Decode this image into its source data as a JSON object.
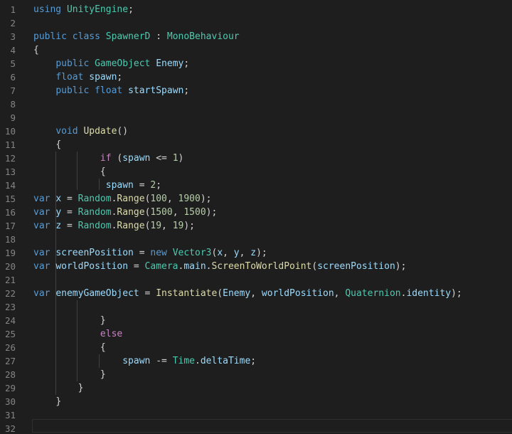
{
  "editor": {
    "language": "csharp",
    "theme_colors": {
      "background": "#1e1e1e",
      "keyword": "#569cd6",
      "control": "#c586c0",
      "type": "#4ec9b0",
      "function": "#dcdcaa",
      "variable": "#9cdcfe",
      "number": "#b5cea8",
      "line_number": "#858585"
    },
    "lines": [
      {
        "n": "1",
        "tokens": [
          {
            "t": "using",
            "c": "kw"
          },
          {
            "t": " "
          },
          {
            "t": "UnityEngine",
            "c": "type"
          },
          {
            "t": ";"
          }
        ]
      },
      {
        "n": "2",
        "tokens": []
      },
      {
        "n": "3",
        "tokens": [
          {
            "t": "public",
            "c": "kw"
          },
          {
            "t": " "
          },
          {
            "t": "class",
            "c": "kw"
          },
          {
            "t": " "
          },
          {
            "t": "SpawnerD",
            "c": "type"
          },
          {
            "t": " : "
          },
          {
            "t": "MonoBehaviour",
            "c": "type"
          }
        ]
      },
      {
        "n": "4",
        "tokens": [
          {
            "t": "{"
          }
        ]
      },
      {
        "n": "5",
        "tokens": [
          {
            "t": "    "
          },
          {
            "t": "public",
            "c": "kw"
          },
          {
            "t": " "
          },
          {
            "t": "GameObject",
            "c": "type"
          },
          {
            "t": " "
          },
          {
            "t": "Enemy",
            "c": "var"
          },
          {
            "t": ";"
          }
        ]
      },
      {
        "n": "6",
        "tokens": [
          {
            "t": "    "
          },
          {
            "t": "float",
            "c": "kw"
          },
          {
            "t": " "
          },
          {
            "t": "spawn",
            "c": "var"
          },
          {
            "t": ";"
          }
        ]
      },
      {
        "n": "7",
        "tokens": [
          {
            "t": "    "
          },
          {
            "t": "public",
            "c": "kw"
          },
          {
            "t": " "
          },
          {
            "t": "float",
            "c": "kw"
          },
          {
            "t": " "
          },
          {
            "t": "startSpawn",
            "c": "var"
          },
          {
            "t": ";"
          }
        ]
      },
      {
        "n": "8",
        "tokens": []
      },
      {
        "n": "9",
        "tokens": []
      },
      {
        "n": "10",
        "tokens": [
          {
            "t": "    "
          },
          {
            "t": "void",
            "c": "kw"
          },
          {
            "t": " "
          },
          {
            "t": "Update",
            "c": "fn"
          },
          {
            "t": "()"
          }
        ]
      },
      {
        "n": "11",
        "tokens": [
          {
            "t": "    "
          },
          {
            "t": "{"
          }
        ]
      },
      {
        "n": "12",
        "tokens": [
          {
            "t": "            "
          },
          {
            "t": "if",
            "c": "ctl"
          },
          {
            "t": " ("
          },
          {
            "t": "spawn",
            "c": "var"
          },
          {
            "t": " <= "
          },
          {
            "t": "1",
            "c": "num"
          },
          {
            "t": ")"
          }
        ]
      },
      {
        "n": "13",
        "tokens": [
          {
            "t": "            "
          },
          {
            "t": "{"
          }
        ]
      },
      {
        "n": "14",
        "tokens": [
          {
            "t": "             "
          },
          {
            "t": "spawn",
            "c": "var"
          },
          {
            "t": " = "
          },
          {
            "t": "2",
            "c": "num"
          },
          {
            "t": ";"
          }
        ]
      },
      {
        "n": "15",
        "tokens": [
          {
            "t": "var",
            "c": "kw"
          },
          {
            "t": " "
          },
          {
            "t": "x",
            "c": "var"
          },
          {
            "t": " = "
          },
          {
            "t": "Random",
            "c": "type"
          },
          {
            "t": "."
          },
          {
            "t": "Range",
            "c": "fn"
          },
          {
            "t": "("
          },
          {
            "t": "100",
            "c": "num"
          },
          {
            "t": ", "
          },
          {
            "t": "1900",
            "c": "num"
          },
          {
            "t": ");"
          }
        ]
      },
      {
        "n": "16",
        "tokens": [
          {
            "t": "var",
            "c": "kw"
          },
          {
            "t": " "
          },
          {
            "t": "y",
            "c": "var"
          },
          {
            "t": " = "
          },
          {
            "t": "Random",
            "c": "type"
          },
          {
            "t": "."
          },
          {
            "t": "Range",
            "c": "fn"
          },
          {
            "t": "("
          },
          {
            "t": "1500",
            "c": "num"
          },
          {
            "t": ", "
          },
          {
            "t": "1500",
            "c": "num"
          },
          {
            "t": ");"
          }
        ]
      },
      {
        "n": "17",
        "tokens": [
          {
            "t": "var",
            "c": "kw"
          },
          {
            "t": " "
          },
          {
            "t": "z",
            "c": "var"
          },
          {
            "t": " = "
          },
          {
            "t": "Random",
            "c": "type"
          },
          {
            "t": "."
          },
          {
            "t": "Range",
            "c": "fn"
          },
          {
            "t": "("
          },
          {
            "t": "19",
            "c": "num"
          },
          {
            "t": ", "
          },
          {
            "t": "19",
            "c": "num"
          },
          {
            "t": ");"
          }
        ]
      },
      {
        "n": "18",
        "tokens": []
      },
      {
        "n": "19",
        "tokens": [
          {
            "t": "var",
            "c": "kw"
          },
          {
            "t": " "
          },
          {
            "t": "screenPosition",
            "c": "var"
          },
          {
            "t": " = "
          },
          {
            "t": "new",
            "c": "kw"
          },
          {
            "t": " "
          },
          {
            "t": "Vector3",
            "c": "type"
          },
          {
            "t": "("
          },
          {
            "t": "x",
            "c": "var"
          },
          {
            "t": ", "
          },
          {
            "t": "y",
            "c": "var"
          },
          {
            "t": ", "
          },
          {
            "t": "z",
            "c": "var"
          },
          {
            "t": ");"
          }
        ]
      },
      {
        "n": "20",
        "tokens": [
          {
            "t": "var",
            "c": "kw"
          },
          {
            "t": " "
          },
          {
            "t": "worldPosition",
            "c": "var"
          },
          {
            "t": " = "
          },
          {
            "t": "Camera",
            "c": "type"
          },
          {
            "t": "."
          },
          {
            "t": "main",
            "c": "var"
          },
          {
            "t": "."
          },
          {
            "t": "ScreenToWorldPoint",
            "c": "fn"
          },
          {
            "t": "("
          },
          {
            "t": "screenPosition",
            "c": "var"
          },
          {
            "t": ");"
          }
        ]
      },
      {
        "n": "21",
        "tokens": []
      },
      {
        "n": "22",
        "tokens": [
          {
            "t": "var",
            "c": "kw"
          },
          {
            "t": " "
          },
          {
            "t": "enemyGameObject",
            "c": "var"
          },
          {
            "t": " = "
          },
          {
            "t": "Instantiate",
            "c": "fn"
          },
          {
            "t": "("
          },
          {
            "t": "Enemy",
            "c": "var"
          },
          {
            "t": ", "
          },
          {
            "t": "worldPosition",
            "c": "var"
          },
          {
            "t": ", "
          },
          {
            "t": "Quaternion",
            "c": "type"
          },
          {
            "t": "."
          },
          {
            "t": "identity",
            "c": "var"
          },
          {
            "t": ");"
          }
        ]
      },
      {
        "n": "23",
        "tokens": []
      },
      {
        "n": "24",
        "tokens": [
          {
            "t": "            "
          },
          {
            "t": "}"
          }
        ]
      },
      {
        "n": "25",
        "tokens": [
          {
            "t": "            "
          },
          {
            "t": "else",
            "c": "ctl"
          }
        ]
      },
      {
        "n": "26",
        "tokens": [
          {
            "t": "            "
          },
          {
            "t": "{"
          }
        ]
      },
      {
        "n": "27",
        "tokens": [
          {
            "t": "                "
          },
          {
            "t": "spawn",
            "c": "var"
          },
          {
            "t": " -= "
          },
          {
            "t": "Time",
            "c": "type"
          },
          {
            "t": "."
          },
          {
            "t": "deltaTime",
            "c": "var"
          },
          {
            "t": ";"
          }
        ]
      },
      {
        "n": "28",
        "tokens": [
          {
            "t": "            "
          },
          {
            "t": "}"
          }
        ]
      },
      {
        "n": "29",
        "tokens": [
          {
            "t": "        "
          },
          {
            "t": "}"
          }
        ]
      },
      {
        "n": "30",
        "tokens": [
          {
            "t": "    "
          },
          {
            "t": "}"
          }
        ]
      },
      {
        "n": "31",
        "tokens": []
      },
      {
        "n": "32",
        "tokens": []
      }
    ]
  }
}
